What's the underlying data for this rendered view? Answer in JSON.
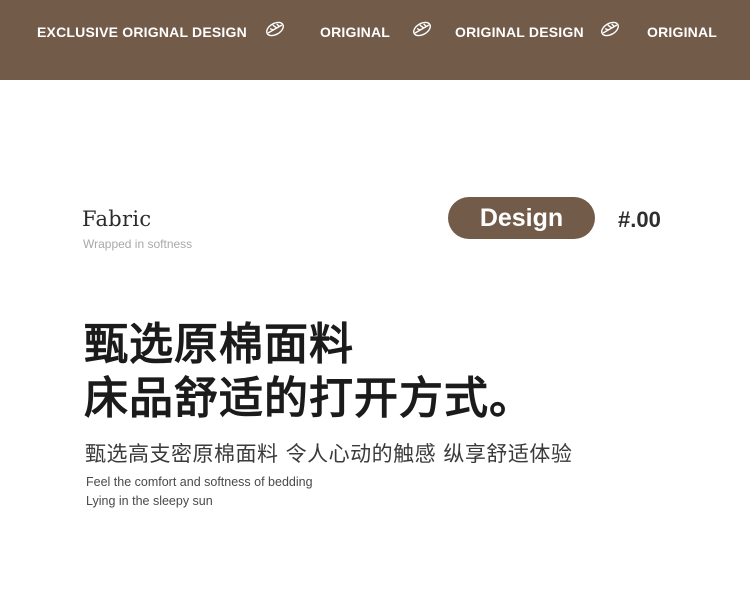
{
  "banner": {
    "background": "#725b49",
    "items": [
      {
        "label": "EXCLUSIVE ORIGNAL DESIGN"
      },
      {
        "label": "ORIGINAL"
      },
      {
        "label": "ORIGINAL DESIGN"
      },
      {
        "label": "ORIGINAL"
      }
    ],
    "icon": "leaf-icon"
  },
  "fabric": {
    "title": "Fabric",
    "subtitle": "Wrapped in softness"
  },
  "design_tag": {
    "label": "Design",
    "number": "#.00",
    "color": "#725b49"
  },
  "headline": {
    "line1": "甄选原棉面料",
    "line2": "床品舒适的打开方式。"
  },
  "subline": "甄选高支密原棉面料 令人心动的触感 纵享舒适体验",
  "english": {
    "line1": "Feel the comfort and softness of bedding",
    "line2": "Lying in the sleepy sun"
  }
}
